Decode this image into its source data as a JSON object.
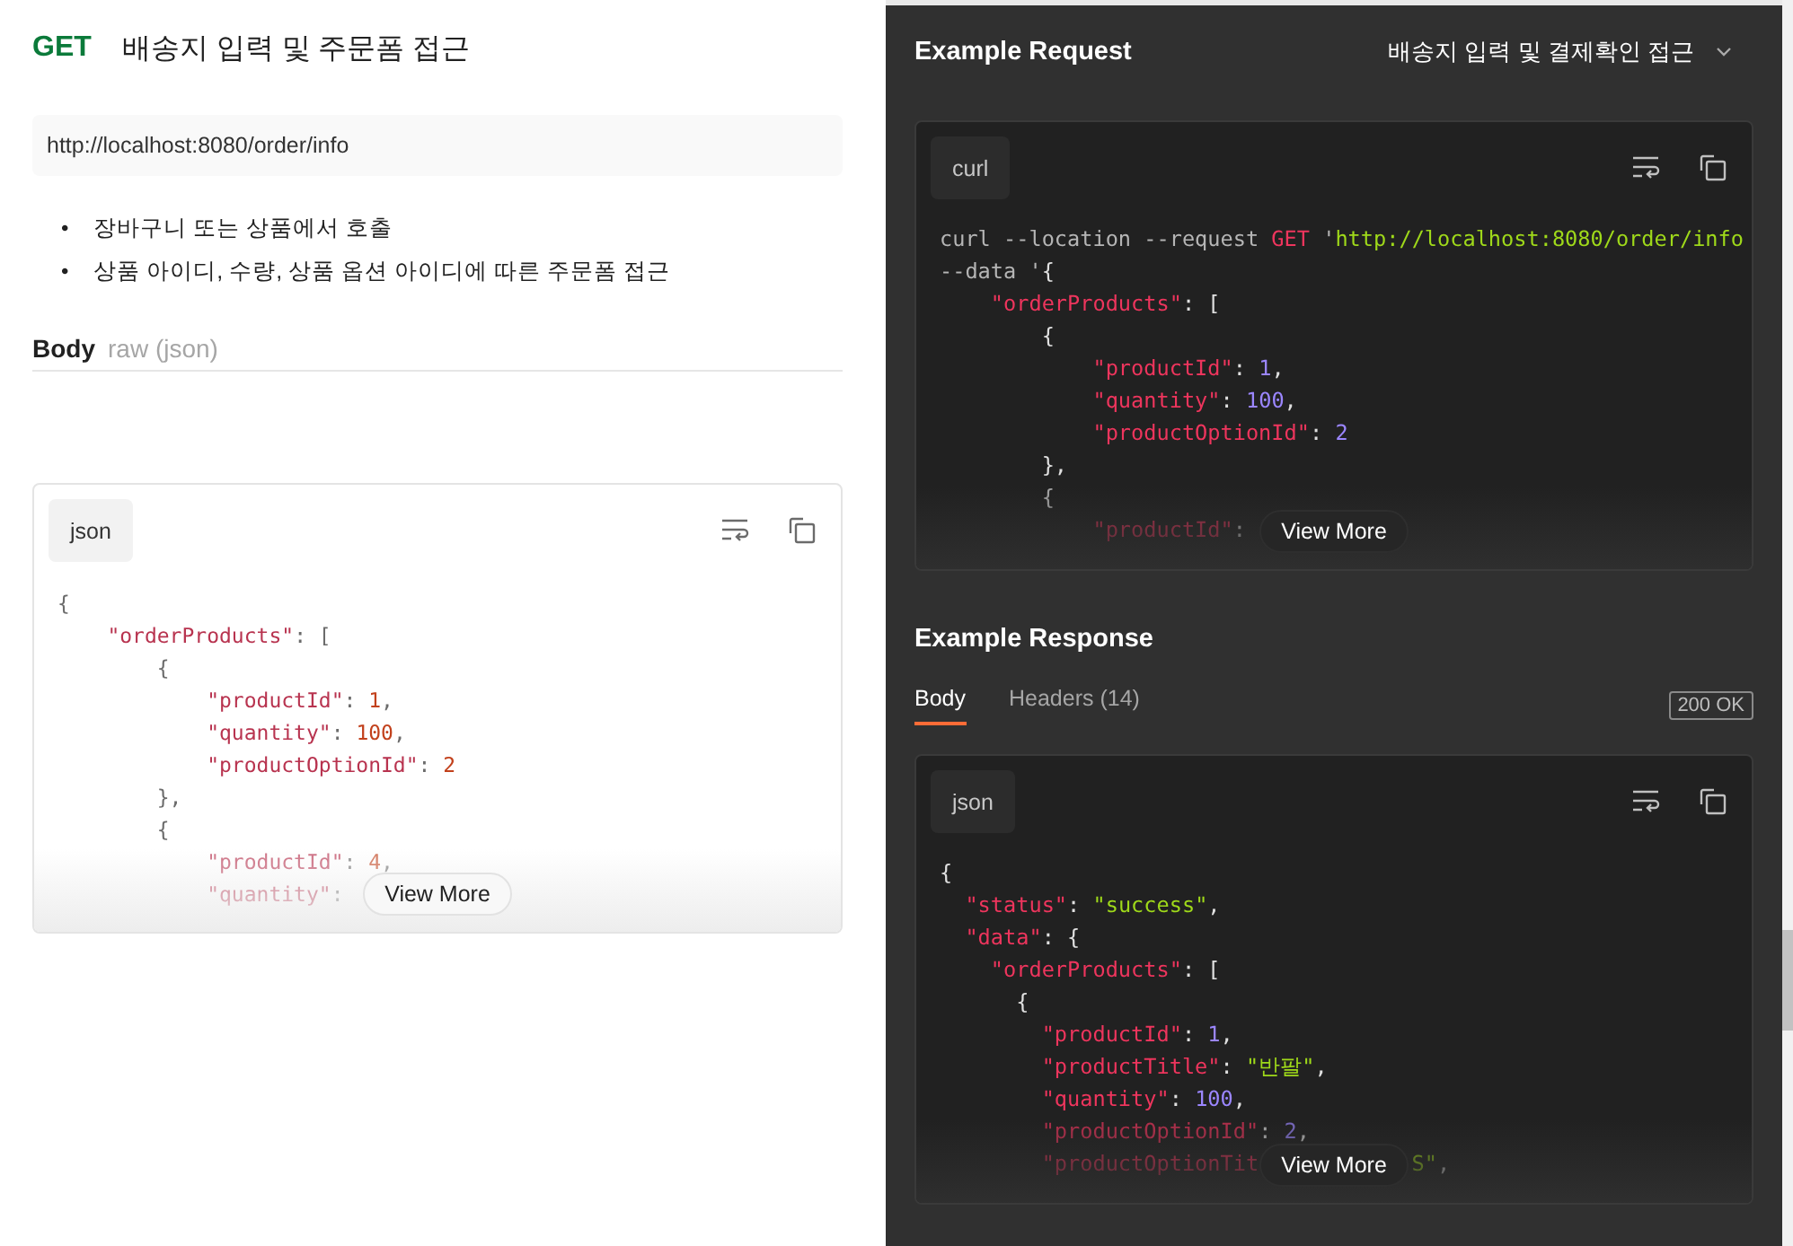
{
  "request": {
    "method": "GET",
    "title": "배송지 입력 및 주문폼 접근",
    "url": "http://localhost:8080/order/info",
    "notes": [
      {
        "marker": "•",
        "text": "장바구니 또는 상품에서 호출"
      },
      {
        "marker": "•",
        "text": "상품 아이디, 수량, 상품 옵션 아이디에 따른 주문폼 접근"
      }
    ],
    "body": {
      "label": "Body",
      "mode": "raw (json)",
      "language": "json",
      "view_more": "View More",
      "lines": [
        {
          "tokens": [
            {
              "kind": "punct",
              "t": "{"
            }
          ]
        },
        {
          "tokens": [
            {
              "kind": "key",
              "t": "    \"orderProducts\""
            },
            {
              "kind": "punct",
              "t": ": ["
            }
          ]
        },
        {
          "tokens": [
            {
              "kind": "punct",
              "t": "        {"
            }
          ]
        },
        {
          "tokens": [
            {
              "kind": "key",
              "t": "            \"productId\""
            },
            {
              "kind": "punct",
              "t": ": "
            },
            {
              "kind": "num",
              "t": "1"
            },
            {
              "kind": "punct",
              "t": ","
            }
          ]
        },
        {
          "tokens": [
            {
              "kind": "key",
              "t": "            \"quantity\""
            },
            {
              "kind": "punct",
              "t": ": "
            },
            {
              "kind": "num",
              "t": "100"
            },
            {
              "kind": "punct",
              "t": ","
            }
          ]
        },
        {
          "tokens": [
            {
              "kind": "key",
              "t": "            \"productOptionId\""
            },
            {
              "kind": "punct",
              "t": ": "
            },
            {
              "kind": "num",
              "t": "2"
            }
          ]
        },
        {
          "tokens": [
            {
              "kind": "punct",
              "t": "        },"
            }
          ]
        },
        {
          "tokens": [
            {
              "kind": "punct",
              "t": "        {"
            }
          ]
        },
        {
          "tokens": [
            {
              "kind": "key",
              "t": "            \"productId\""
            },
            {
              "kind": "punct",
              "t": ": "
            },
            {
              "kind": "num",
              "t": "4"
            },
            {
              "kind": "punct",
              "t": ","
            }
          ]
        },
        {
          "tokens": [
            {
              "kind": "key",
              "t": "            \"quantity\""
            },
            {
              "kind": "punct",
              "t": ":"
            }
          ]
        }
      ]
    }
  },
  "example_request": {
    "heading": "Example Request",
    "selector": "배송지 입력 및 결제확인 접근",
    "language": "curl",
    "view_more": "View More",
    "lines": [
      {
        "tokens": [
          {
            "kind": "plain",
            "t": "curl --location --request "
          },
          {
            "kind": "kw",
            "t": "GET"
          },
          {
            "kind": "plain",
            "t": " '"
          },
          {
            "kind": "str",
            "t": "http://localhost:8080/order/info"
          }
        ]
      },
      {
        "tokens": [
          {
            "kind": "plain",
            "t": "--data '"
          },
          {
            "kind": "punct",
            "t": "{"
          }
        ]
      },
      {
        "tokens": [
          {
            "kind": "key",
            "t": "    \"orderProducts\""
          },
          {
            "kind": "punct",
            "t": ": ["
          }
        ]
      },
      {
        "tokens": [
          {
            "kind": "punct",
            "t": "        {"
          }
        ]
      },
      {
        "tokens": [
          {
            "kind": "key",
            "t": "            \"productId\""
          },
          {
            "kind": "punct",
            "t": ": "
          },
          {
            "kind": "num",
            "t": "1"
          },
          {
            "kind": "punct",
            "t": ","
          }
        ]
      },
      {
        "tokens": [
          {
            "kind": "key",
            "t": "            \"quantity\""
          },
          {
            "kind": "punct",
            "t": ": "
          },
          {
            "kind": "num",
            "t": "100"
          },
          {
            "kind": "punct",
            "t": ","
          }
        ]
      },
      {
        "tokens": [
          {
            "kind": "key",
            "t": "            \"productOptionId\""
          },
          {
            "kind": "punct",
            "t": ": "
          },
          {
            "kind": "num",
            "t": "2"
          }
        ]
      },
      {
        "tokens": [
          {
            "kind": "punct",
            "t": "        },"
          }
        ]
      },
      {
        "tokens": [
          {
            "kind": "punct",
            "t": "        {"
          }
        ]
      },
      {
        "tokens": [
          {
            "kind": "key",
            "t": "            \"productId\""
          },
          {
            "kind": "punct",
            "t": ":"
          }
        ]
      }
    ]
  },
  "example_response": {
    "heading": "Example Response",
    "tabs": [
      {
        "label": "Body",
        "selected": true
      },
      {
        "label": "Headers (14)",
        "selected": false
      }
    ],
    "status": "200 OK",
    "language": "json",
    "view_more": "View More",
    "lines": [
      {
        "tokens": [
          {
            "kind": "punct",
            "t": "{"
          }
        ]
      },
      {
        "tokens": [
          {
            "kind": "key",
            "t": "  \"status\""
          },
          {
            "kind": "punct",
            "t": ": "
          },
          {
            "kind": "str",
            "t": "\"success\""
          },
          {
            "kind": "punct",
            "t": ","
          }
        ]
      },
      {
        "tokens": [
          {
            "kind": "key",
            "t": "  \"data\""
          },
          {
            "kind": "punct",
            "t": ": {"
          }
        ]
      },
      {
        "tokens": [
          {
            "kind": "key",
            "t": "    \"orderProducts\""
          },
          {
            "kind": "punct",
            "t": ": ["
          }
        ]
      },
      {
        "tokens": [
          {
            "kind": "punct",
            "t": "      {"
          }
        ]
      },
      {
        "tokens": [
          {
            "kind": "key",
            "t": "        \"productId\""
          },
          {
            "kind": "punct",
            "t": ": "
          },
          {
            "kind": "num",
            "t": "1"
          },
          {
            "kind": "punct",
            "t": ","
          }
        ]
      },
      {
        "tokens": [
          {
            "kind": "key",
            "t": "        \"productTitle\""
          },
          {
            "kind": "punct",
            "t": ": "
          },
          {
            "kind": "str",
            "t": "\"반팔\""
          },
          {
            "kind": "punct",
            "t": ","
          }
        ]
      },
      {
        "tokens": [
          {
            "kind": "key",
            "t": "        \"quantity\""
          },
          {
            "kind": "punct",
            "t": ": "
          },
          {
            "kind": "num",
            "t": "100"
          },
          {
            "kind": "punct",
            "t": ","
          }
        ]
      },
      {
        "tokens": [
          {
            "kind": "key",
            "t": "        \"productOptionId\""
          },
          {
            "kind": "punct",
            "t": ": "
          },
          {
            "kind": "num",
            "t": "2"
          },
          {
            "kind": "punct",
            "t": ","
          }
        ]
      },
      {
        "tokens": [
          {
            "kind": "key",
            "t": "        \"productOptionTit"
          }
        ],
        "after": [
          {
            "kind": "str",
            "t": "S\""
          },
          {
            "kind": "punct",
            "t": ","
          }
        ]
      }
    ]
  }
}
